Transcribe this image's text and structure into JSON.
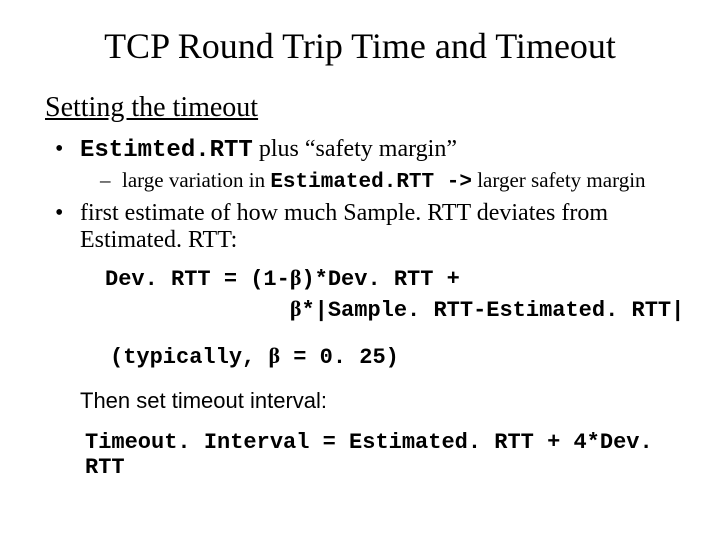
{
  "title": "TCP Round Trip Time and Timeout",
  "subhead": "Setting the timeout",
  "b1_mono": "Estimted.RTT",
  "b1_rest": " plus “safety margin”",
  "sub1_a": "large variation in ",
  "sub1_mono": "Estimated.RTT ->",
  "sub1_b": " larger safety margin",
  "b2": "first estimate of how much Sample. RTT deviates from Estimated. RTT:",
  "formula_l1a": "Dev. RTT = (1-",
  "formula_l1b": ")*Dev. RTT +",
  "formula_l2a": "              ",
  "formula_l2b": "*|Sample. RTT-Estimated. RTT|",
  "typical_a": "(typically, ",
  "typical_b": " = 0. 25)",
  "then": "Then set timeout interval:",
  "timeout": "Timeout. Interval = Estimated. RTT + 4*Dev. RTT",
  "beta": "β"
}
